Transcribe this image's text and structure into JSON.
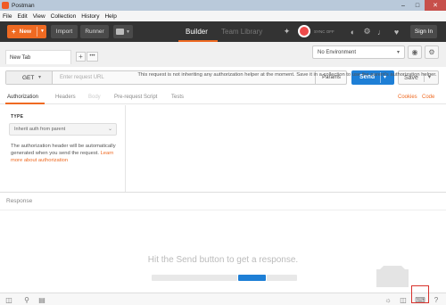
{
  "window": {
    "title": "Postman"
  },
  "menu": [
    "File",
    "Edit",
    "View",
    "Collection",
    "History",
    "Help"
  ],
  "toolbar": {
    "new_label": "New",
    "import_label": "Import",
    "runner_label": "Runner",
    "builder_label": "Builder",
    "team_library_label": "Team Library",
    "sync_label": "SYNC OFF",
    "signin_label": "Sign In"
  },
  "tabs": {
    "request_tab_label": "New Tab",
    "add_label": "+",
    "more_label": "•••"
  },
  "environment": {
    "selected": "No Environment"
  },
  "request": {
    "method": "GET",
    "url_placeholder": "Enter request URL",
    "params_label": "Params",
    "send_label": "Send",
    "save_label": "Save"
  },
  "request_tabs": {
    "items": [
      "Authorization",
      "Headers",
      "Body",
      "Pre-request Script",
      "Tests"
    ],
    "cookies": "Cookies",
    "code": "Code"
  },
  "auth": {
    "type_label": "TYPE",
    "selected": "Inherit auth from parent",
    "description": "The authorization header will be automatically generated when you send the request.",
    "learn_more": "Learn more about authorization",
    "info": "This request is not inheriting any authorization helper at the moment. Save it in a collection to use the parent's authorization helper."
  },
  "response": {
    "label": "Response",
    "hint": "Hit the Send button to get a response."
  },
  "colors": {
    "accent": "#ef6a22",
    "send": "#1e7fd6",
    "toolbar": "#333333",
    "highlight": "#d8322c"
  }
}
